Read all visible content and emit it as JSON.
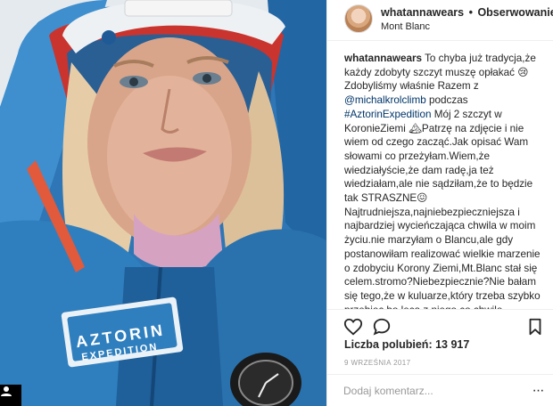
{
  "post": {
    "username": "whatannawears",
    "separator": "•",
    "follow_label": "Obserwowanie",
    "location": "Mont Blanc",
    "photo_brand_line1": "AZTORIN",
    "photo_brand_line2": "EXPEDITION"
  },
  "caption": {
    "author": "whatannawears",
    "text1": "To chyba już tradycja,że każdy zdobyty szczyt muszę opłakać 😢 Zdobyliśmy właśnie Razem z",
    "mention": "@michalkrolclimb",
    "text2": "podczas",
    "hashtag": "#AztorinExpedition",
    "text3": "Mój 2 szczyt w KoronieZiemi 🏔Patrzę na zdjęcie i nie wiem od czego zacząć.Jak opisać Wam słowami co przeżyłam.Wiem,że wiedziałyście,że dam radę,ja też wiedziałam,ale nie sądziłam,że to będzie tak STRASZNE😖",
    "text4": "Najtrudniejsza,najniebezpieczniejsza i najbardziej wycieńczająca chwila w moim życiu.nie marzyłam o Blancu,ale gdy postanowiłam realizować wielkie marzenie o zdobyciu Korony Ziemi,Mt.Blanc stał się celem.stromo?Niebezpiecznie?Nie bałam się tego,że w kuluarze,który trzeba szybko przebiec,bo lecą z niego co chwile zabójcze kamienie,ani wąskich tylko na dwie stopy grani gdzie po obu stronach sa"
  },
  "actions": {
    "like_icon": "heart-icon",
    "comment_icon": "speech-bubble-icon",
    "save_icon": "bookmark-icon"
  },
  "stats": {
    "likes": "Liczba polubień: 13 917",
    "date": "9 WRZEŚNIA 2017"
  },
  "comment": {
    "placeholder": "Dodaj komentarz...",
    "more_label": "···"
  },
  "colors": {
    "link": "#003569",
    "border": "#efefef",
    "muted": "#999999",
    "jacket_blue": "#2f7fbf"
  }
}
